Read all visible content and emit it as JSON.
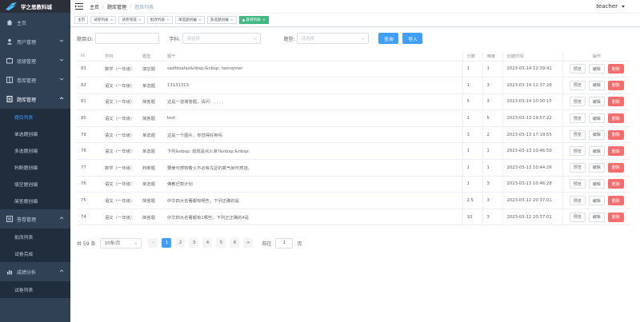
{
  "app": {
    "logo_text": "学之思教科城"
  },
  "sidebar": {
    "items": [
      {
        "label": "主页",
        "icon": "home-icon",
        "has_arrow": false
      },
      {
        "label": "用户管理",
        "icon": "user-icon",
        "has_arrow": true
      },
      {
        "label": "班级管理",
        "icon": "class-icon",
        "has_arrow": true
      },
      {
        "label": "卷库管理",
        "icon": "library-icon",
        "has_arrow": true
      },
      {
        "label": "题库管理",
        "icon": "question-icon",
        "has_arrow": true,
        "open": true
      }
    ],
    "question_sub": [
      "题目列表",
      "单选题创编",
      "多选题创编",
      "判断题创编",
      "填空题创编",
      "简答题创编"
    ],
    "answer_menu": {
      "label": "答卷管理",
      "icon": "answer-icon"
    },
    "answer_sub": [
      "批改列表",
      "试卷完成"
    ],
    "stat_menu": {
      "label": "成绩分析",
      "icon": "chart-icon"
    },
    "stat_sub": [
      "试卷列表"
    ]
  },
  "header": {
    "breadcrumb": [
      "主页",
      "题库管理",
      "题目列表"
    ],
    "user": "teacher"
  },
  "tags": [
    "主页",
    "试卷列表",
    "试卷完成",
    "批改列表",
    "单选题创编",
    "多选题创编",
    "题目列表"
  ],
  "search": {
    "id_label": "题目ID:",
    "subject_label": "学科:",
    "subject_placeholder": "请选择",
    "type_label": "题型:",
    "type_placeholder": "请选择",
    "query_btn": "查询",
    "add_btn": "导入"
  },
  "table": {
    "headers": [
      "Id",
      "学科",
      "题型",
      "题干",
      "分数",
      "难度",
      "创建时间",
      "操作"
    ],
    "actions": {
      "preview": "预览",
      "edit": "编辑",
      "delete": "删除"
    },
    "rows": [
      {
        "id": "83",
        "subject": "数学（一年级）",
        "type": "填空题",
        "stem": "sadfdsafas&nbsp;&nbsp; twerqrewr",
        "score": "1",
        "difficulty": "1",
        "time": "2023-03-14 12:39:41"
      },
      {
        "id": "82",
        "subject": "语文（一年级）",
        "type": "单选题",
        "stem": "13131313",
        "score": "1",
        "difficulty": "3",
        "time": "2023-03-14 12:37:28"
      },
      {
        "id": "81",
        "subject": "语文（一年级）",
        "type": "简答题",
        "stem": "这是一道简答题，请问：. . . .",
        "score": "5",
        "difficulty": "3",
        "time": "2023-03-14 10:00:15"
      },
      {
        "id": "80",
        "subject": "语文（一年级）",
        "type": "简答题",
        "stem": "test",
        "score": "1",
        "difficulty": "5",
        "time": "2023-03-13 19:57:22"
      },
      {
        "id": "79",
        "subject": "语文（一年级）",
        "type": "单选题",
        "stem": "这是一个图片，你觉得好用吗",
        "score": "3",
        "difficulty": "2",
        "time": "2023-03-13 17:19:55"
      },
      {
        "id": "78",
        "subject": "语文（一年级）",
        "type": "单选题",
        "stem": "下列&nbsp; 熄熄是点火液?&nbsp;&nbsp;",
        "score": "1",
        "difficulty": "1",
        "time": "2023-03-13 10:46:50"
      },
      {
        "id": "77",
        "subject": "数学（一年级）",
        "type": "判断题",
        "stem": "要使可燃物着火不必有充足的氧气就可燃烧。",
        "score": "1",
        "difficulty": "1",
        "time": "2023-03-13 10:44:26"
      },
      {
        "id": "76",
        "subject": "语文（一年级）",
        "type": "单选题",
        "stem": "佛教迁款计划",
        "score": "1",
        "difficulty": "3",
        "time": "2023-03-13 10:46:28"
      },
      {
        "id": "75",
        "subject": "语文（一年级）",
        "type": "简答题",
        "stem": "中华四大名著都有哪些，下列正确的是",
        "score": "2.5",
        "difficulty": "3",
        "time": "2023-03-12 20:37:01"
      },
      {
        "id": "74",
        "subject": "语文（一年级）",
        "type": "简答题",
        "stem": "中华四大名著都有1哪些，下列正正确的4是",
        "score": "10",
        "difficulty": "3",
        "time": "2023-03-12 20:37:01"
      }
    ]
  },
  "pagination": {
    "total": "共 59 条",
    "page_size": "10条/页",
    "prev": "<",
    "pages": [
      "1",
      "2",
      "3",
      "4",
      "5",
      "6"
    ],
    "current": "1",
    "next": ">",
    "goto_label": "前往",
    "goto_value": "1",
    "page_suffix": "页"
  },
  "colors": {
    "sidebar_bg": "#304156",
    "primary": "#409eff",
    "danger": "#f56c6c",
    "active_tag": "#42b983"
  }
}
